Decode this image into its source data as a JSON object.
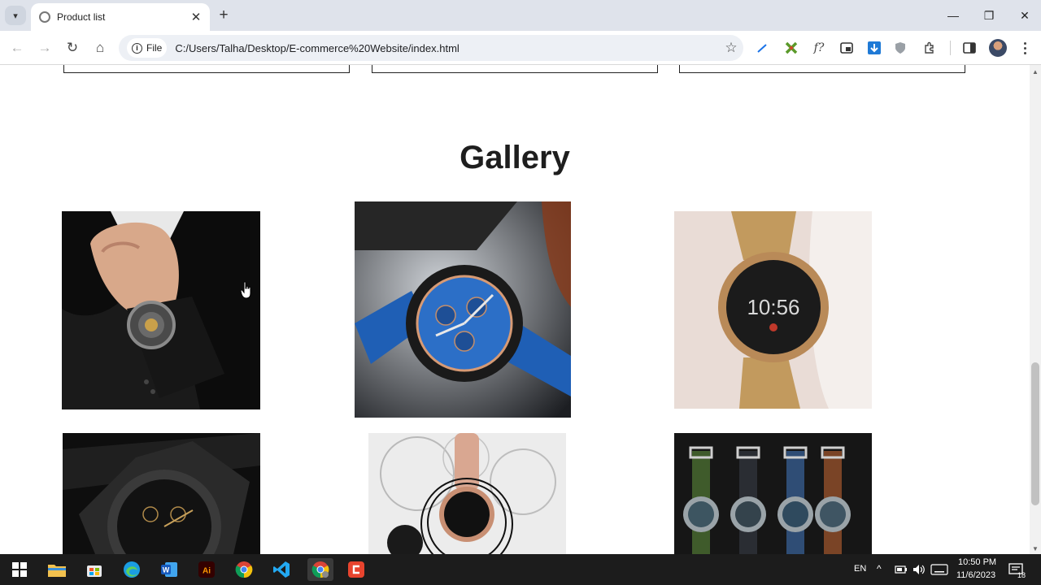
{
  "browser": {
    "tab_title": "Product list",
    "url_chip": "File",
    "url": "C:/Users/Talha/Desktop/E-commerce%20Website/index.html"
  },
  "page": {
    "gallery_heading": "Gallery",
    "gallery_images": [
      {
        "name": "watch-on-wrist-suit"
      },
      {
        "name": "blue-chronograph-watch"
      },
      {
        "name": "rose-gold-smartwatch"
      },
      {
        "name": "black-dial-watch"
      },
      {
        "name": "pink-strap-smartwatch"
      },
      {
        "name": "leather-strap-watch-set"
      }
    ],
    "smartwatch_time": "10:56"
  },
  "taskbar": {
    "language": "EN",
    "time": "10:50 PM",
    "date": "11/6/2023",
    "notification_count": "18"
  },
  "colors": {
    "tabstrip": "#dfe3eb",
    "taskbar": "#1c1c1c",
    "omnibox": "#edf0f5"
  }
}
